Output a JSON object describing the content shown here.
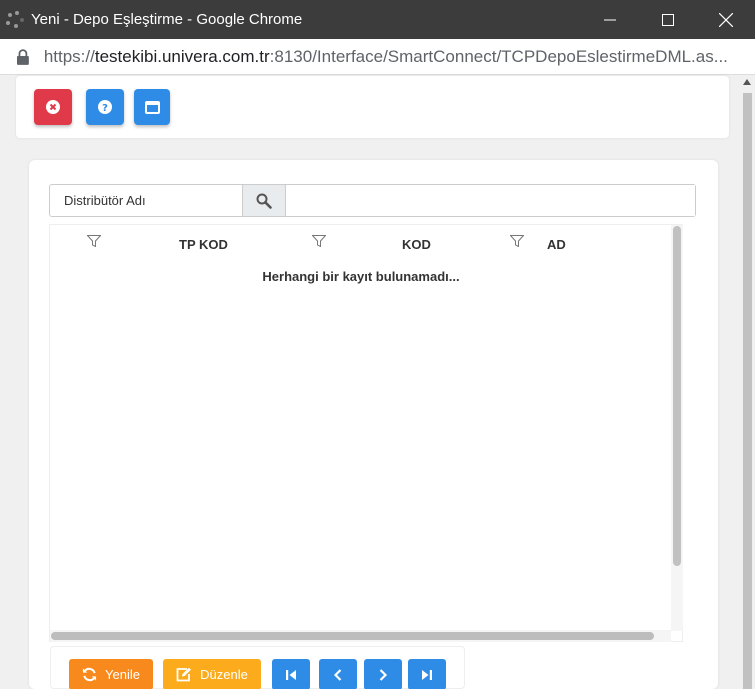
{
  "window": {
    "title": "Yeni - Depo Eşleştirme - Google Chrome",
    "minimize": "—",
    "maximize": "☐",
    "close": "✕"
  },
  "address": {
    "scheme": "https://",
    "host": "testekibi.univera.com.tr",
    "rest": ":8130/Interface/SmartConnect/TCPDepoEslestirmeDML.as..."
  },
  "toolbar": {
    "close_icon": "close-circle-icon",
    "help_icon": "question-circle-icon",
    "window_icon": "window-icon"
  },
  "search": {
    "label": "Distribütör Adı",
    "value": "",
    "placeholder": ""
  },
  "grid": {
    "columns": [
      "TP KOD",
      "KOD",
      "AD"
    ],
    "empty_message": "Herhangi bir kayıt bulunamadı..."
  },
  "actions": {
    "refresh_label": "Yenile",
    "edit_label": "Düzenle"
  },
  "colors": {
    "danger": "#e0394a",
    "primary": "#2e8be6",
    "orange": "#f88a1d",
    "amber": "#fbab1b"
  }
}
